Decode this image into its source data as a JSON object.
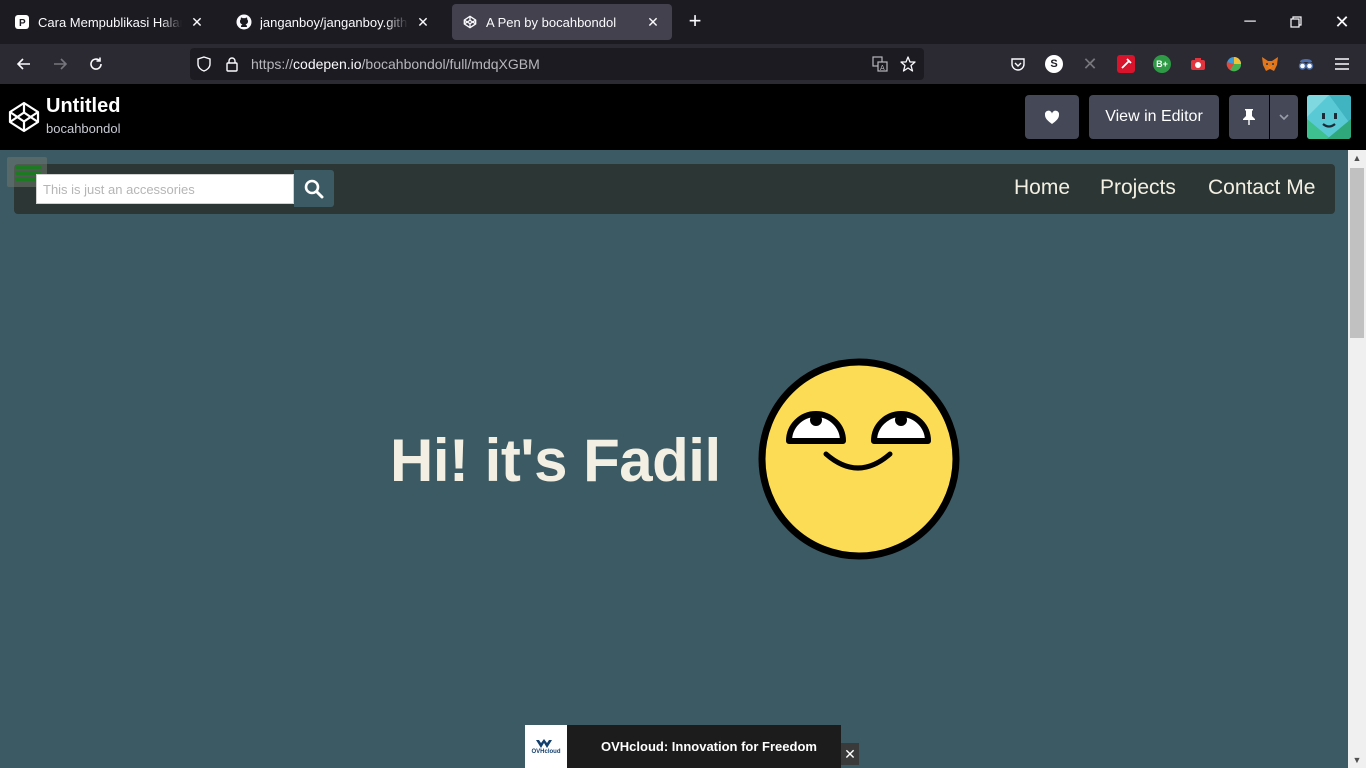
{
  "browser": {
    "tabs": [
      {
        "title": "Cara Mempublikasi Halaman Web",
        "icon": "pixiv-icon",
        "active": false
      },
      {
        "title": "janganboy/janganboy.github.io",
        "icon": "github-icon",
        "active": false
      },
      {
        "title": "A Pen by bocahbondol",
        "icon": "codepen-icon",
        "active": true
      }
    ],
    "url_prefix": "https://",
    "url_host": "codepen.io",
    "url_path": "/bocahbondol/full/mdqXGBM"
  },
  "codepen": {
    "title": "Untitled",
    "user": "bocahbondol",
    "view_in_editor": "View in Editor"
  },
  "site": {
    "search_placeholder": "This is just an accessories",
    "nav": [
      "Home",
      "Projects",
      "Contact Me"
    ],
    "hero": "Hi! it's Fadil"
  },
  "ad": {
    "brand": "OVHcloud",
    "text": "OVHcloud: Innovation for Freedom"
  },
  "colors": {
    "page_bg": "#3c5a64",
    "nav_bg": "#2c3634",
    "hero_text": "#f3efe2",
    "smiley_face": "#fddc55"
  }
}
